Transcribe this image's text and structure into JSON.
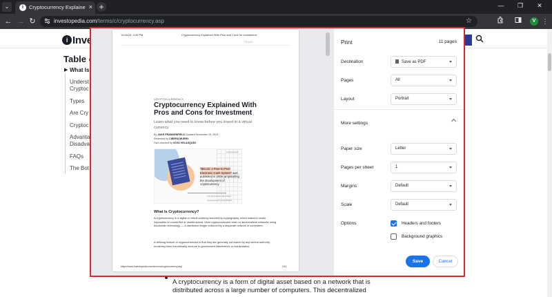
{
  "browser": {
    "tab_title": "Cryptocurrency Explained With",
    "tab_close": "×",
    "new_tab": "+",
    "url_host": "investopedia.com",
    "url_path": "/terms/c/cryptocurrency.asp",
    "profile_initial": "V",
    "icons": [
      "chevron-down-icon",
      "back-icon",
      "forward-icon",
      "reload-icon",
      "lock-icon",
      "star-icon",
      "extensions-icon",
      "side-panel-icon",
      "kebab-menu-icon",
      "minimize-icon",
      "maximize-icon",
      "close-icon"
    ]
  },
  "page": {
    "logo_text": "Inve",
    "toc_title": "Table o",
    "toc_items": [
      "What Is",
      "Underst",
      "Cryptoc",
      "Types",
      "Are Cry",
      "Cryptoc",
      "Advanta",
      "Disadva",
      "FAQs",
      "The Bot"
    ],
    "body_lines": [
      "A cryptocurrency is a form of digital asset based on a network that is",
      "distributed across a large number of computers. This decentralized"
    ]
  },
  "print_preview": {
    "paper": {
      "header_date": "11/16/23, 3:20 PM",
      "header_title": "Cryptocurrency Explained With Pros and Cons for Investment",
      "ad_label": "TRADE",
      "kicker": "CRYPTOCURRENCY",
      "title": "Cryptocurrency Explained With Pros and Cons for Investment",
      "subtitle": "Learn what you need to know before you invest in a virtual currency.",
      "byline_prefix": "By",
      "author": "JAKE FRANKENFIELD",
      "updated": "Updated November 16, 2023",
      "reviewed_prefix": "Reviewed by",
      "reviewer": "CIERRA MURRY",
      "factcheck_prefix": "Fact checked by",
      "factchecker": "VIVIO VELASQUEZ",
      "figure_brand": "Investopedia",
      "figure_highlight": "\"Bitcoin: A Peer-to-Peer Electronic Cash System\"",
      "figure_rest": "was published in 2008 jumpstarting the development of cryptocurrency.",
      "figure_caption_1": "The first blocks have been",
      "figure_caption_2": "Cryptocurrency was Bitcoin",
      "section_title": "What Is Cryptocurrency?",
      "para1": "A cryptocurrency is a digital or virtual currency secured by cryptography, which makes it nearly impossible to counterfeit or double-spend. Most cryptocurrencies exist on decentralized networks using blockchain technology — a distributed ledger enforced by a disparate network of computers.",
      "para2": "A defining feature of cryptocurrencies is that they are generally not issued by any central authority, rendering them theoretically immune to government interference or manipulation.",
      "footer_url": "https://www.investopedia.com/terms/c/cryptocurrency.asp",
      "footer_page": "1/11"
    },
    "settings": {
      "title": "Print",
      "page_count": "11 pages",
      "destination_label": "Destination",
      "destination_value": "Save as PDF",
      "pages_label": "Pages",
      "pages_value": "All",
      "layout_label": "Layout",
      "layout_value": "Portrait",
      "more_settings_label": "More settings",
      "paper_size_label": "Paper size",
      "paper_size_value": "Letter",
      "pages_per_sheet_label": "Pages per sheet",
      "pages_per_sheet_value": "1",
      "margins_label": "Margins",
      "margins_value": "Default",
      "scale_label": "Scale",
      "scale_value": "Default",
      "options_label": "Options",
      "headers_footers_label": "Headers and footers",
      "headers_footers_checked": true,
      "background_graphics_label": "Background graphics",
      "background_graphics_checked": false,
      "save_label": "Save",
      "cancel_label": "Cancel"
    },
    "highlight_color": "#d7272a"
  }
}
